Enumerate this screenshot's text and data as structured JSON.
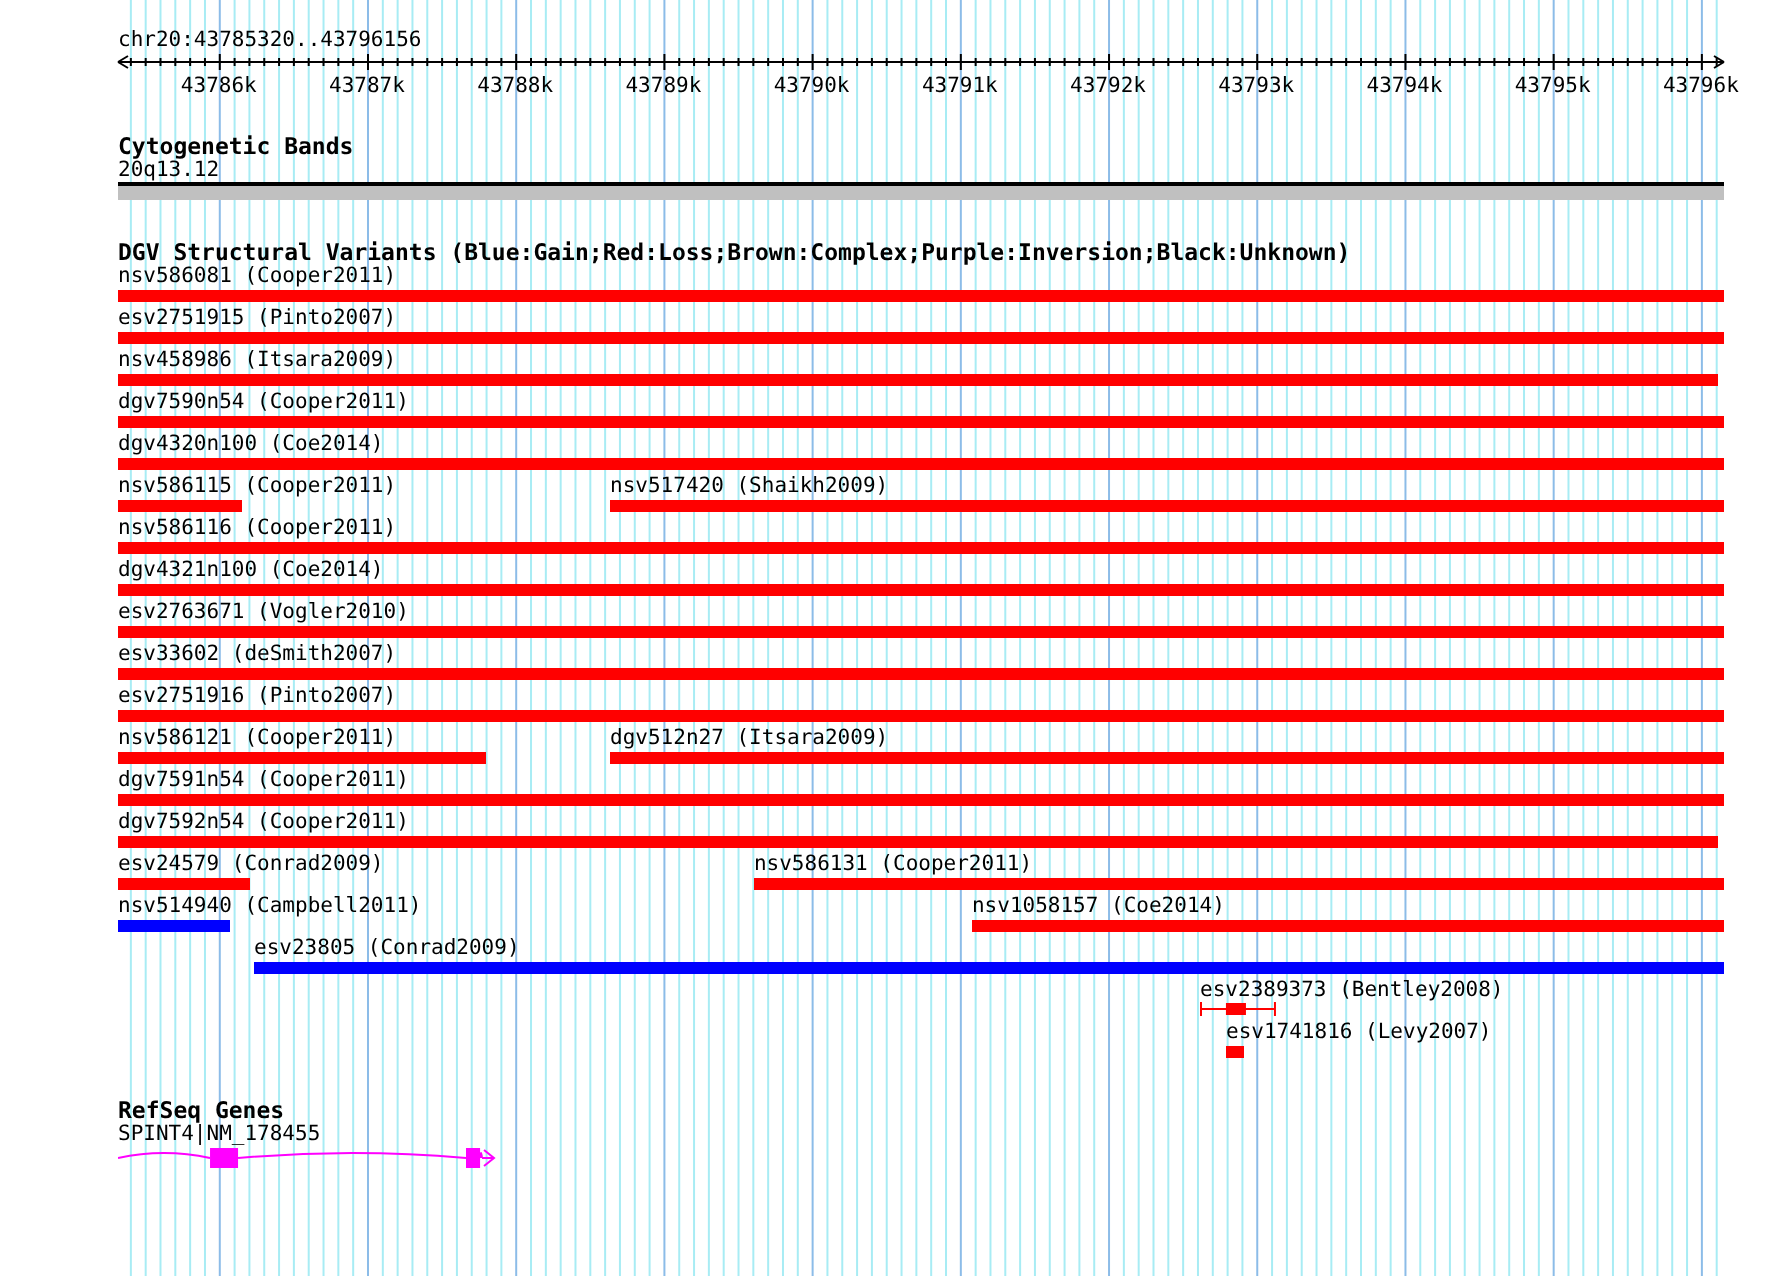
{
  "ruler": {
    "region": "chr20:43785320..43796156",
    "ticks": [
      "43786k",
      "43787k",
      "43788k",
      "43789k",
      "43790k",
      "43791k",
      "43792k",
      "43793k",
      "43794k",
      "43795k",
      "43796k"
    ]
  },
  "cytogenetic_bands": {
    "title": "Cytogenetic Bands",
    "band": "20q13.12"
  },
  "structural_variants": {
    "title": "DGV Structural Variants (Blue:Gain;Red:Loss;Brown:Complex;Purple:Inversion;Black:Unknown)",
    "rows": [
      {
        "features": [
          {
            "name": "nsv586081 (Cooper2011)",
            "kind": "bar",
            "color": "#ff0000"
          }
        ]
      },
      {
        "features": [
          {
            "name": "esv2751915 (Pinto2007)",
            "kind": "bar",
            "color": "#ff0000"
          }
        ]
      },
      {
        "features": [
          {
            "name": "nsv458986 (Itsara2009)",
            "kind": "bar",
            "color": "#ff0000"
          }
        ]
      },
      {
        "features": [
          {
            "name": "dgv7590n54 (Cooper2011)",
            "kind": "bar",
            "color": "#ff0000"
          }
        ]
      },
      {
        "features": [
          {
            "name": "dgv4320n100 (Coe2014)",
            "kind": "bar",
            "color": "#ff0000"
          }
        ]
      },
      {
        "features": [
          {
            "name": "nsv586115 (Cooper2011)",
            "kind": "bar",
            "color": "#ff0000"
          },
          {
            "name": "nsv517420 (Shaikh2009)",
            "kind": "bar",
            "color": "#ff0000"
          }
        ]
      },
      {
        "features": [
          {
            "name": "nsv586116 (Cooper2011)",
            "kind": "bar",
            "color": "#ff0000"
          }
        ]
      },
      {
        "features": [
          {
            "name": "dgv4321n100 (Coe2014)",
            "kind": "bar",
            "color": "#ff0000"
          }
        ]
      },
      {
        "features": [
          {
            "name": "esv2763671 (Vogler2010)",
            "kind": "bar",
            "color": "#ff0000"
          }
        ]
      },
      {
        "features": [
          {
            "name": "esv33602 (deSmith2007)",
            "kind": "bar",
            "color": "#ff0000"
          }
        ]
      },
      {
        "features": [
          {
            "name": "esv2751916 (Pinto2007)",
            "kind": "bar",
            "color": "#ff0000"
          }
        ]
      },
      {
        "features": [
          {
            "name": "nsv586121 (Cooper2011)",
            "kind": "bar",
            "color": "#ff0000"
          },
          {
            "name": "dgv512n27 (Itsara2009)",
            "kind": "bar",
            "color": "#ff0000"
          }
        ]
      },
      {
        "features": [
          {
            "name": "dgv7591n54 (Cooper2011)",
            "kind": "bar",
            "color": "#ff0000"
          }
        ]
      },
      {
        "features": [
          {
            "name": "dgv7592n54 (Cooper2011)",
            "kind": "bar",
            "color": "#ff0000"
          }
        ]
      },
      {
        "features": [
          {
            "name": "esv24579 (Conrad2009)",
            "kind": "bar",
            "color": "#ff0000"
          },
          {
            "name": "nsv586131 (Cooper2011)",
            "kind": "bar",
            "color": "#ff0000"
          }
        ]
      },
      {
        "features": [
          {
            "name": "nsv514940 (Campbell2011)",
            "kind": "bar",
            "color": "#0000ff"
          },
          {
            "name": "nsv1058157 (Coe2014)",
            "kind": "bar",
            "color": "#ff0000"
          }
        ]
      },
      {
        "features": [
          {
            "name": "esv23805 (Conrad2009)",
            "kind": "bar",
            "color": "#0000ff"
          }
        ]
      },
      {
        "features": [
          {
            "name": "esv2389373 (Bentley2008)",
            "kind": "range",
            "color": "#ff0000"
          }
        ]
      },
      {
        "features": [
          {
            "name": "esv1741816 (Levy2007)",
            "kind": "bar",
            "color": "#ff0000"
          }
        ]
      }
    ]
  },
  "refseq_genes": {
    "title": "RefSeq Genes",
    "genes": [
      {
        "label": "SPINT4|NM_178455"
      }
    ]
  }
}
